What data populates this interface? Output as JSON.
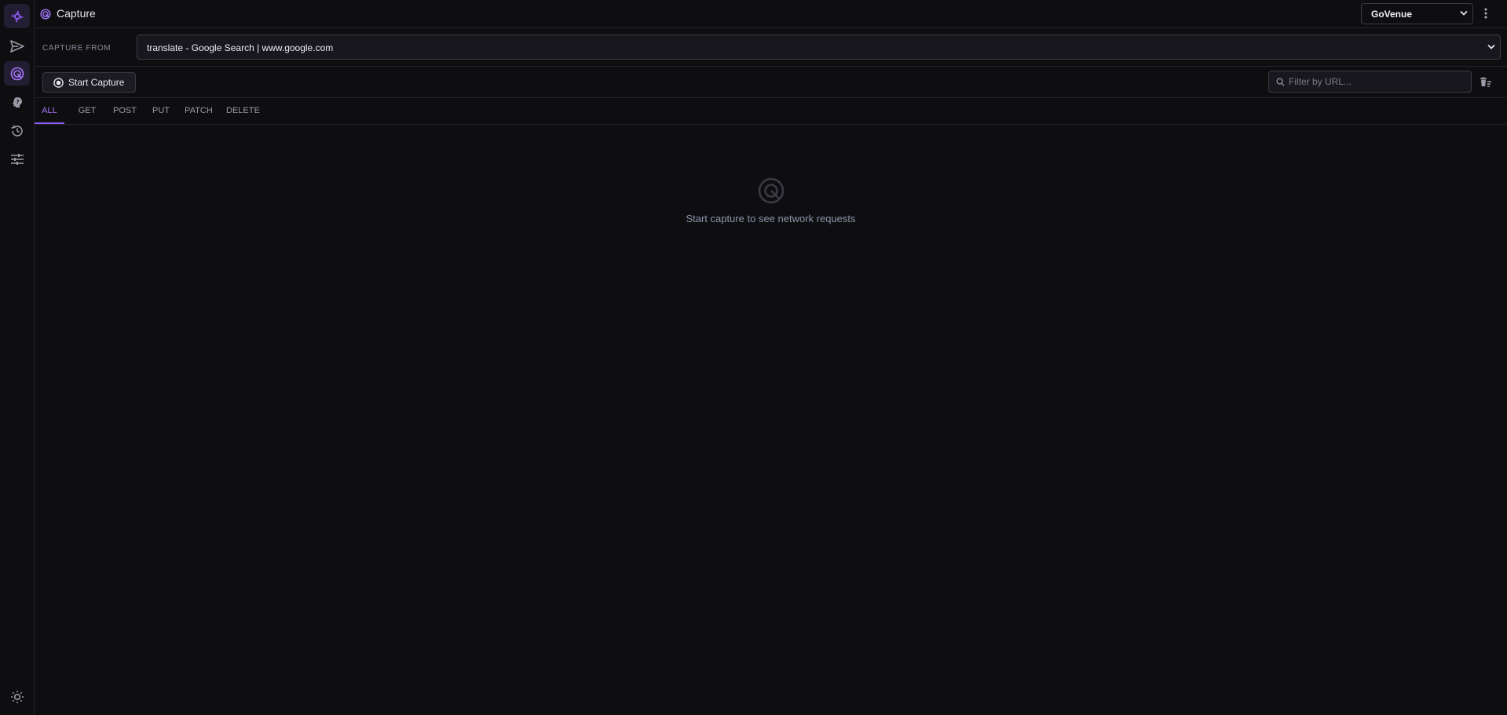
{
  "app": {
    "title": "Capture"
  },
  "icons": {
    "logo": "logo-icon",
    "send": "send-icon",
    "capture": "capture-icon",
    "help": "help-icon",
    "history": "history-icon",
    "settings": "sliders-icon",
    "theme": "sun-icon"
  },
  "workspace": {
    "selected": "GoVenue"
  },
  "capture_from": {
    "label": "CAPTURE FROM",
    "selected": "translate - Google Search | www.google.com"
  },
  "toolbar": {
    "start_label": "Start Capture",
    "filter_placeholder": "Filter by URL..."
  },
  "tabs": [
    {
      "label": "ALL",
      "active": true
    },
    {
      "label": "GET"
    },
    {
      "label": "POST"
    },
    {
      "label": "PUT"
    },
    {
      "label": "PATCH"
    },
    {
      "label": "DELETE"
    }
  ],
  "empty_state": {
    "text": "Start capture to see network requests"
  },
  "colors": {
    "accent": "#8b5cf6",
    "background": "#0e0e11",
    "border": "#23232a"
  }
}
